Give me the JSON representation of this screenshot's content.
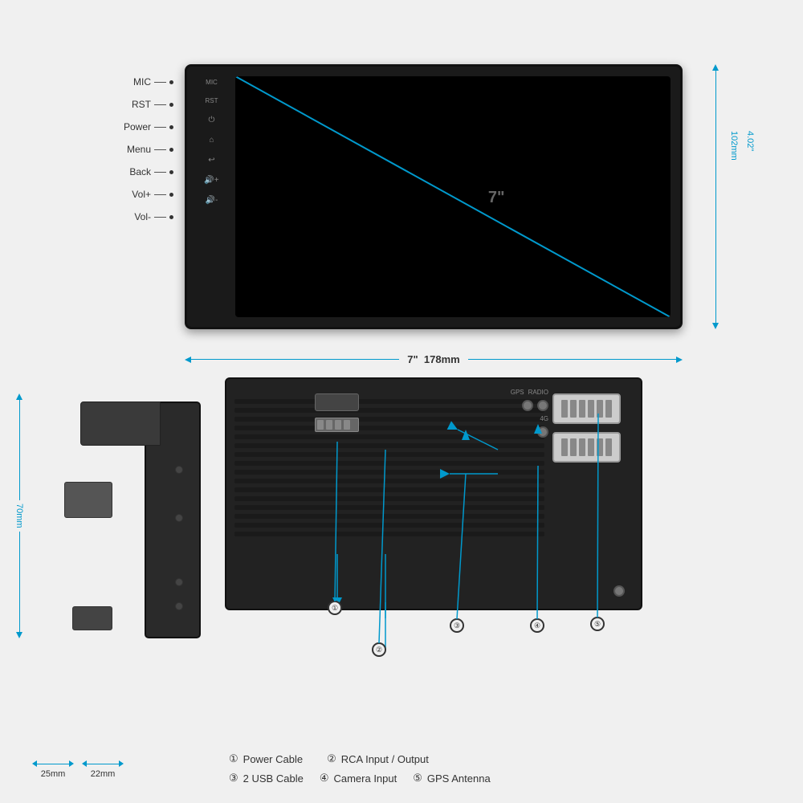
{
  "page": {
    "background": "#f0f0f0"
  },
  "front_view": {
    "screen_label": "7\"",
    "controls": [
      {
        "id": "mic-label",
        "text": "MIC",
        "symbol": "MIC"
      },
      {
        "id": "rst-label",
        "text": "RST",
        "symbol": "RST"
      },
      {
        "id": "power-label",
        "text": "Power",
        "symbol": "⏻"
      },
      {
        "id": "menu-label",
        "text": "Menu",
        "symbol": "🏠"
      },
      {
        "id": "back-label",
        "text": "Back",
        "symbol": "↩"
      },
      {
        "id": "vol-plus-label",
        "text": "Vol+",
        "symbol": "🔊+"
      },
      {
        "id": "vol-minus-label",
        "text": "Vol-",
        "symbol": "🔊-"
      }
    ],
    "dimensions": {
      "width_inch": "7\"",
      "width_mm": "178mm",
      "height_inch": "4.02\"",
      "height_mm": "102mm"
    }
  },
  "side_view": {
    "dimensions": {
      "depth": "70mm",
      "width1": "25mm",
      "width2": "22mm"
    }
  },
  "rear_view": {
    "connectors": [
      "Power Cable",
      "RCA Input/Output",
      "2 USB Cable",
      "Camera Input",
      "GPS Antenna"
    ]
  },
  "legend": {
    "items": [
      {
        "number": "①",
        "label": "Power Cable"
      },
      {
        "number": "②",
        "label": "RCA Input / Output"
      },
      {
        "number": "③",
        "label": "2 USB Cable"
      },
      {
        "number": "④",
        "label": "Camera Input"
      },
      {
        "number": "⑤",
        "label": "GPS Antenna"
      }
    ]
  }
}
